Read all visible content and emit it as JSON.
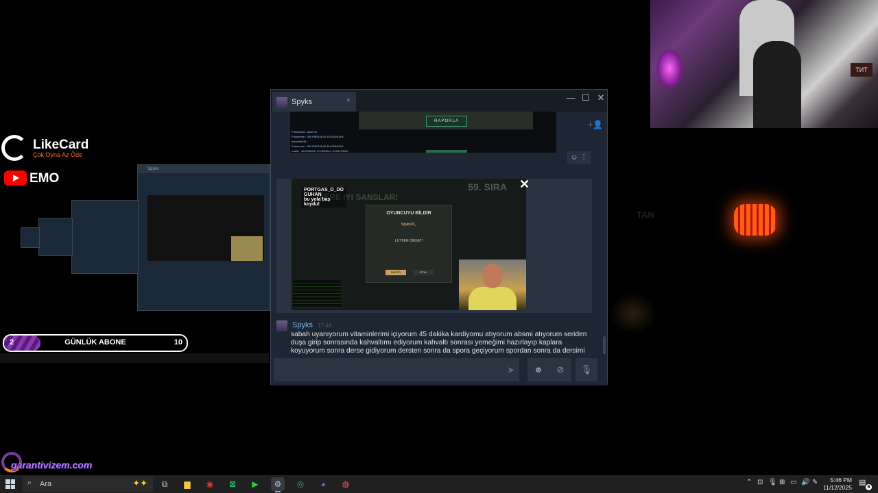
{
  "overlay": {
    "likecard_name": "LikeCard",
    "likecard_tagline": "Çok Oyna   Az Öde",
    "youtube_label": "EMO",
    "goal": {
      "current": "2",
      "label": "GÜNLÜK ABONE",
      "target": "10",
      "progress": 0.2
    },
    "garanti": "garantivizem.com",
    "ghost_text": "TAN"
  },
  "chat_window": {
    "tab_name": "Spyks",
    "tab_close": "×",
    "controls": {
      "minimize": "—",
      "maximize": "☐",
      "close": "✕"
    },
    "add_friend_icon": "+👤",
    "preview_button": "RAPORLA",
    "preview_chat_lines": [
      "Protecto63 : abse do",
      "Furkanmm : 300 PARA ALDI EN AZINDAN",
      "azizmetin36 : ",
      "Furkanmm : 300 PARA ALDI EN AZINDAN",
      "xvadb : JEVENDGK GYLEMGLV JLSHLVSDG"
    ],
    "screenshot": {
      "caption_1": "PORTGAS_D_DO",
      "caption_2": "GUHAN",
      "caption_3": "bu yola baş",
      "caption_4": "koydu!",
      "bg_text": "FERE IYI SANSLAR!",
      "rank": "59. SIRA",
      "popup_title": "OYUNCUYU BİLDİR",
      "popup_name": "Spyks26_",
      "popup_warn": "LÜTFEN DİKKAT!",
      "popup_ok": "RAPOR",
      "popup_cancel": "İPTAL",
      "close": "✕"
    },
    "message": {
      "author": "Spyks",
      "time": "17:44",
      "text": "sabah uyanıyorum vitaminlerimi içiyorum 45 dakika kardiyomu atıyorum absmi atıyorum seriden duşa girip sonrasında kahvaltımı ediyorum kahvaltı sonrası yemeğimi hazırlayıp kaplara koyuyorum sonra derse gidiyorum dersten sonra da spora geçiyorum spordan sonra da dersimi çalışıyorum dersten sonra da arkadaşlarımla sohbet muhabbet oyun falan"
    },
    "composer": {
      "value": "",
      "placeholder": ""
    }
  },
  "taskbar": {
    "search_placeholder": "Ara",
    "clock_time": "5:46 PM",
    "clock_date": "11/12/2025",
    "notification_count": "6"
  },
  "colors": {
    "accent": "#6fb6e8",
    "window_bg": "#1e2633",
    "goal_fill": "#8a3ab0"
  }
}
